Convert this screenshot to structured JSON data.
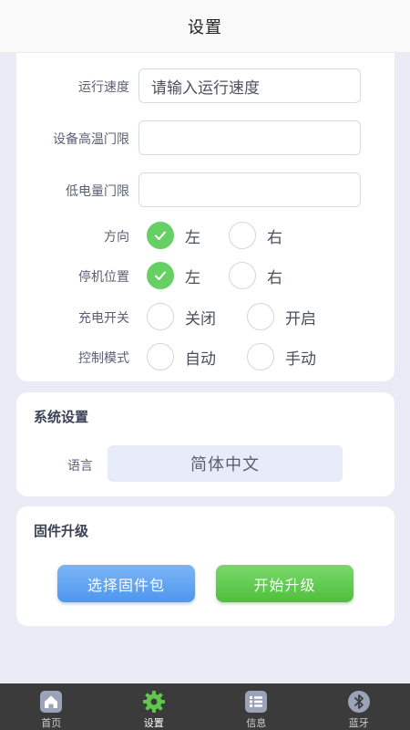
{
  "header": {
    "title": "设置"
  },
  "params": {
    "run_speed": {
      "label": "运行速度",
      "value": "",
      "placeholder": "请输入运行速度"
    },
    "high_temp": {
      "label": "设备高温门限",
      "value": ""
    },
    "low_battery": {
      "label": "低电量门限",
      "value": ""
    }
  },
  "options": {
    "direction": {
      "label": "方向",
      "left": "左",
      "right": "右",
      "selected": "左"
    },
    "stop_position": {
      "label": "停机位置",
      "left": "左",
      "right": "右",
      "selected": "左"
    },
    "charge_switch": {
      "label": "充电开关",
      "off": "关闭",
      "on": "开启",
      "selected": ""
    },
    "control_mode": {
      "label": "控制模式",
      "auto": "自动",
      "manual": "手动",
      "selected": ""
    }
  },
  "system": {
    "title": "系统设置",
    "language_label": "语言",
    "language_value": "简体中文"
  },
  "firmware": {
    "title": "固件升级",
    "select_button": "选择固件包",
    "start_button": "开始升级"
  },
  "tabs": [
    {
      "label": "首页",
      "icon": "home-icon"
    },
    {
      "label": "设置",
      "icon": "gear-icon",
      "active": true
    },
    {
      "label": "信息",
      "icon": "list-icon"
    },
    {
      "label": "蓝牙",
      "icon": "bluetooth-icon"
    }
  ],
  "colors": {
    "accent_green": "#66d064",
    "button_blue": "#5a9ff0",
    "button_green": "#5cc84a",
    "tab_active": "#5fc84a",
    "tab_inactive": "#9aa3b8"
  }
}
